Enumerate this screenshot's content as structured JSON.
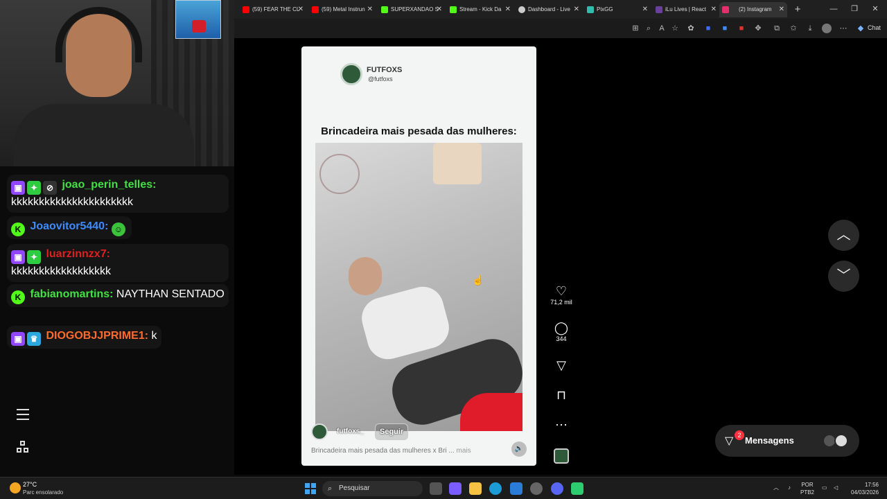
{
  "browser": {
    "tabs": [
      {
        "label": "(59) FEAR THE CL",
        "color": "#ff0000"
      },
      {
        "label": "(59) Metal Instrun",
        "color": "#ff0000"
      },
      {
        "label": "SUPERXANDAO S",
        "color": "#53fc18"
      },
      {
        "label": "Stream - Kick Da",
        "color": "#53fc18"
      },
      {
        "label": "Dashboard - Live",
        "color": "#cccccc"
      },
      {
        "label": "PixGG",
        "color": "#32bcad"
      },
      {
        "label": "iLu Lives | React",
        "color": "#6a3fa0"
      },
      {
        "label": "(2) Instagram",
        "color": "#e1306c"
      }
    ],
    "chat_button": "Chat"
  },
  "chat": {
    "messages": [
      {
        "user": "joao_perin_telles:",
        "user_color": "#43e043",
        "text": "kkkkkkkkkkkkkkkkkkkkkk"
      },
      {
        "user": "Joaovitor5440:",
        "user_color": "#3d8bff",
        "text": ""
      },
      {
        "user": "luarzinnzx7:",
        "user_color": "#e02020",
        "text": "kkkkkkkkkkkkkkkkkk"
      },
      {
        "user": "fabianomartins:",
        "user_color": "#43e043",
        "text": "NAYTHAN SENTADO"
      },
      {
        "user": "DIOGOBJJPRIME1:",
        "user_color": "#ff6b2d",
        "text": "k"
      }
    ]
  },
  "reel": {
    "brand": "FUTFOXS",
    "handle": "@futfoxs",
    "headline": "Brincadeira mais pesada das mulheres:",
    "username": "futfoxs_",
    "follow": "Seguir",
    "caption": "Brincadeira mais pesada das mulheres x Bri ...",
    "caption_more": "mais"
  },
  "actions": {
    "likes": "71,2 mil",
    "comments": "344"
  },
  "messages": {
    "label": "Mensagens",
    "count": "2"
  },
  "taskbar": {
    "temp": "27°C",
    "condition": "Parc ensolarado",
    "search": "Pesquisar",
    "lang1": "POR",
    "lang2": "PTB2",
    "time": "17:56",
    "date": "04/03/2026"
  }
}
